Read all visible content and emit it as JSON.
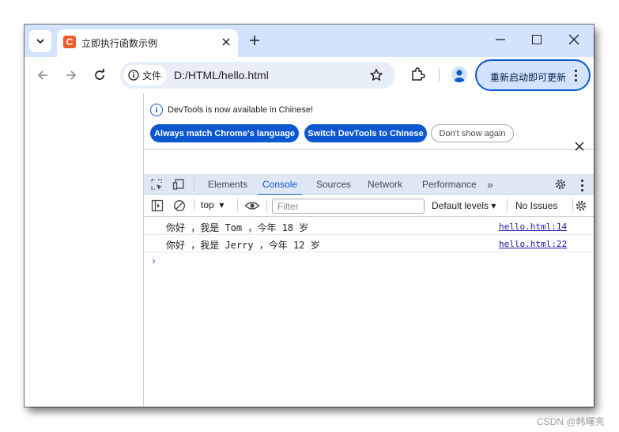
{
  "browser": {
    "tab": {
      "title": "立即执行函数示例",
      "favicon_letter": "C"
    },
    "omnibox": {
      "site_info_label": "文件",
      "url": "D:/HTML/hello.html"
    },
    "update_button_label": "重新启动即可更新"
  },
  "devtools": {
    "infobar": {
      "message": "DevTools is now available in Chinese!",
      "buttons": [
        "Always match Chrome's language",
        "Switch DevTools to Chinese",
        "Don't show again"
      ]
    },
    "tabs": [
      "Elements",
      "Console",
      "Sources",
      "Network",
      "Performance"
    ],
    "overflow_label": "»",
    "active_tab": "Console",
    "console_toolbar": {
      "context": "top",
      "filter_placeholder": "Filter",
      "levels": "Default levels",
      "issues": "No Issues"
    },
    "logs": [
      {
        "message": "你好 ，我是 Tom ，今年 18 岁",
        "source": "hello.html:14"
      },
      {
        "message": "你好 ，我是 Jerry ，今年 12 岁",
        "source": "hello.html:22"
      }
    ],
    "prompt_symbol": "›"
  },
  "watermark": "CSDN @韩曙亮",
  "colors": {
    "tabstrip": "#d3e3fd",
    "accent": "#0b57d0",
    "devtools_tabbar": "#dfe7f4",
    "favicon": "#f25a29",
    "source_link": "#1a1aa6"
  },
  "icons": [
    "chevron-down-icon",
    "close-icon",
    "plus-icon",
    "minimize-icon",
    "maximize-icon",
    "back-arrow-icon",
    "forward-arrow-icon",
    "reload-icon",
    "info-icon",
    "star-icon",
    "extensions-icon",
    "profile-icon",
    "kebab-menu-icon",
    "inspect-icon",
    "device-toggle-icon",
    "gear-icon",
    "sidebar-toggle-icon",
    "clear-console-icon",
    "eye-icon"
  ]
}
